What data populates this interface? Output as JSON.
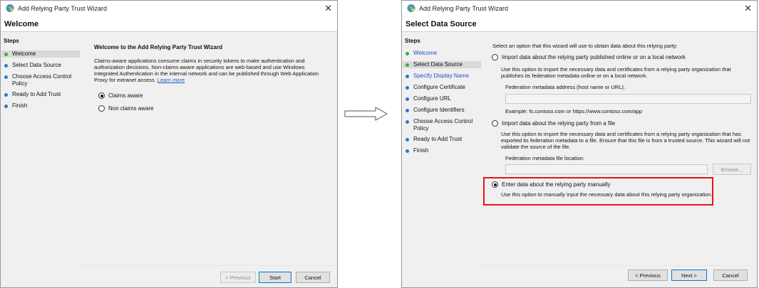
{
  "arrow": "arrow-right-outline-icon",
  "left_window": {
    "title": "Add Relying Party Trust Wizard",
    "page_title": "Welcome",
    "steps_title": "Steps",
    "steps": [
      {
        "label": "Welcome",
        "state": "active",
        "dot": "green"
      },
      {
        "label": "Select Data Source",
        "state": "normal",
        "dot": "blue"
      },
      {
        "label": "Choose Access Control Policy",
        "state": "normal",
        "dot": "blue"
      },
      {
        "label": "Ready to Add Trust",
        "state": "normal",
        "dot": "blue"
      },
      {
        "label": "Finish",
        "state": "normal",
        "dot": "blue"
      }
    ],
    "heading": "Welcome to the Add Relying Party Trust Wizard",
    "description": "Claims-aware applications consume claims in security tokens to make authentication and authorization decisions. Non-claims-aware applications are web-based and use Windows Integrated Authentication in the internal network and can be published through Web Application Proxy for extranet access.",
    "learn_more": "Learn more",
    "options": [
      {
        "label": "Claims aware",
        "checked": true
      },
      {
        "label": "Non claims aware",
        "checked": false
      }
    ],
    "buttons": {
      "previous": "< Previous",
      "start": "Start",
      "cancel": "Cancel"
    }
  },
  "right_window": {
    "title": "Add Relying Party Trust Wizard",
    "page_title": "Select Data Source",
    "steps_title": "Steps",
    "steps": [
      {
        "label": "Welcome",
        "state": "link",
        "dot": "green"
      },
      {
        "label": "Select Data Source",
        "state": "active",
        "dot": "green"
      },
      {
        "label": "Specify Display Name",
        "state": "link",
        "dot": "blue"
      },
      {
        "label": "Configure Certificate",
        "state": "normal",
        "dot": "blue"
      },
      {
        "label": "Configure URL",
        "state": "normal",
        "dot": "blue"
      },
      {
        "label": "Configure Identifiers",
        "state": "normal",
        "dot": "blue"
      },
      {
        "label": "Choose Access Control Policy",
        "state": "normal",
        "dot": "blue"
      },
      {
        "label": "Ready to Add Trust",
        "state": "normal",
        "dot": "blue"
      },
      {
        "label": "Finish",
        "state": "normal",
        "dot": "blue"
      }
    ],
    "intro": "Select an option that this wizard will use to obtain data about this relying party:",
    "option_online": {
      "label": "Import data about the relying party published online or on a local network",
      "checked": false,
      "description": "Use this option to import the necessary data and certificates from a relying party organization that publishes its federation metadata online or on a local network.",
      "field_label": "Federation metadata address (host name or URL):",
      "field_value": "",
      "example": "Example: fs.contoso.com or https://www.contoso.com/app"
    },
    "option_file": {
      "label": "Import data about the relying party from a file",
      "checked": false,
      "description": "Use this option to import the necessary data and certificates from a relying party organization that has exported its federation metadata to a file. Ensure that this file is from a trusted source.  This wizard will not validate the source of the file.",
      "field_label": "Federation metadata file location:",
      "field_value": "",
      "browse": "Browse..."
    },
    "option_manual": {
      "label": "Enter data about the relying party manually",
      "checked": true,
      "description": "Use this option to manually input the necessary data about this relying party organization."
    },
    "highlight_color": "#e8111b",
    "buttons": {
      "previous": "< Previous",
      "next": "Next >",
      "cancel": "Cancel"
    }
  }
}
